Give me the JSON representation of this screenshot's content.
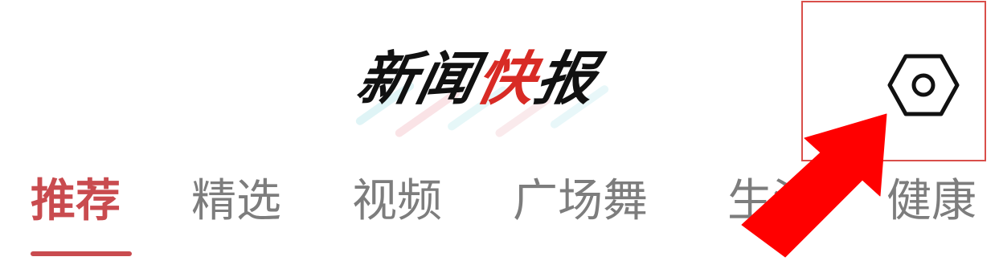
{
  "header": {
    "brand": {
      "part1": "新闻",
      "part2": "快",
      "part3": "报"
    }
  },
  "settings": {
    "icon": "settings-icon",
    "highlight_color": "#d94f4a"
  },
  "tabs": {
    "active_index": 0,
    "items": [
      {
        "label": "推荐"
      },
      {
        "label": "精选"
      },
      {
        "label": "视频"
      },
      {
        "label": "广场舞"
      },
      {
        "label": "生活"
      },
      {
        "label": "健康"
      }
    ]
  },
  "overlay": {
    "arrow_icon": "red-arrow-icon",
    "arrow_color": "#ff0000"
  }
}
